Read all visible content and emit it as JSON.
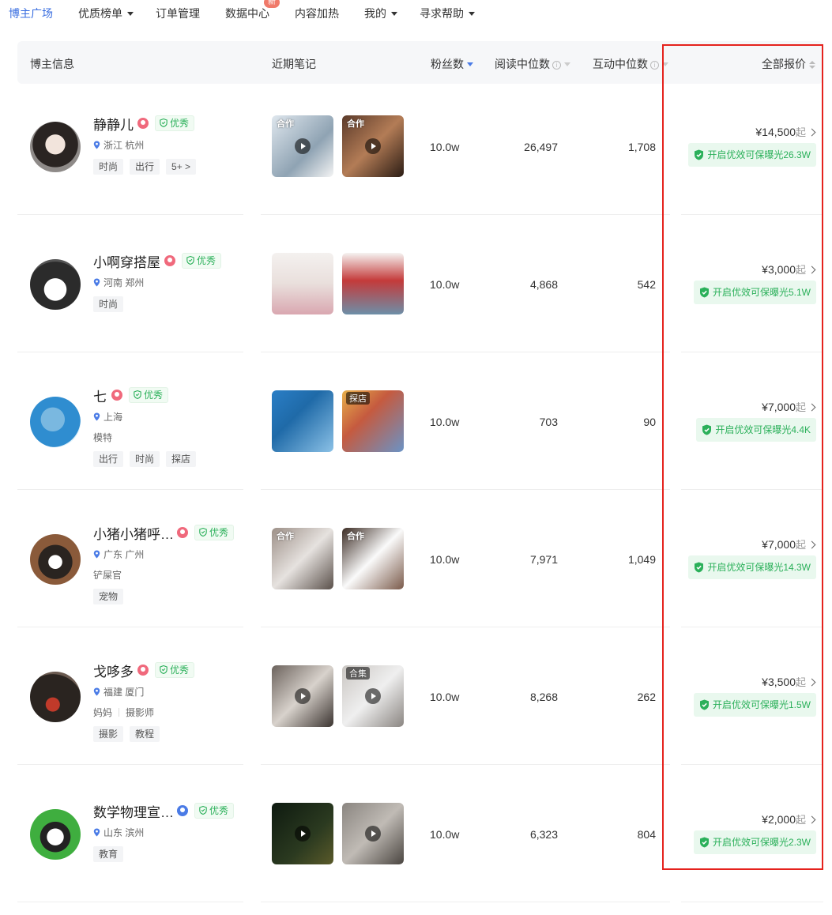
{
  "nav": {
    "items": [
      {
        "label": "博主广场",
        "active": true,
        "dropdown": false
      },
      {
        "label": "优质榜单",
        "active": false,
        "dropdown": true
      },
      {
        "label": "订单管理",
        "active": false,
        "dropdown": false
      },
      {
        "label": "数据中心",
        "active": false,
        "dropdown": false
      },
      {
        "label": "内容加热",
        "active": false,
        "dropdown": false
      },
      {
        "label": "我的",
        "active": false,
        "dropdown": true
      },
      {
        "label": "寻求帮助",
        "active": false,
        "dropdown": true
      }
    ],
    "new_badge": "新"
  },
  "table": {
    "headers": {
      "blogger_info": "博主信息",
      "recent_notes": "近期笔记",
      "fans": "粉丝数",
      "read_median": "阅读中位数",
      "interact_median": "互动中位数",
      "all_price": "全部报价"
    },
    "rows": [
      {
        "name": "静静儿",
        "gender": "female",
        "badge": "优秀",
        "location": "浙江 杭州",
        "roles": [],
        "tags": [
          "时尚",
          "出行",
          "5+ >"
        ],
        "notes": [
          {
            "label": "合作",
            "boxed": false,
            "video": true
          },
          {
            "label": "合作",
            "boxed": false,
            "video": true
          }
        ],
        "fans": "10.0w",
        "read_median": "26,497",
        "interact_median": "1,708",
        "price": "¥14,500",
        "price_suffix": "起",
        "guarantee": "开启优效可保曝光26.3W"
      },
      {
        "name": "小啊穿搭屋",
        "gender": "female",
        "badge": "优秀",
        "location": "河南 郑州",
        "roles": [],
        "tags": [
          "时尚"
        ],
        "notes": [
          {
            "label": "",
            "boxed": false,
            "video": false
          },
          {
            "label": "",
            "boxed": false,
            "video": false
          }
        ],
        "fans": "10.0w",
        "read_median": "4,868",
        "interact_median": "542",
        "price": "¥3,000",
        "price_suffix": "起",
        "guarantee": "开启优效可保曝光5.1W"
      },
      {
        "name": "七",
        "gender": "female",
        "badge": "优秀",
        "location": "上海",
        "roles": [
          "模特"
        ],
        "tags": [
          "出行",
          "时尚",
          "探店"
        ],
        "notes": [
          {
            "label": "",
            "boxed": false,
            "video": false
          },
          {
            "label": "探店",
            "boxed": true,
            "video": false
          }
        ],
        "fans": "10.0w",
        "read_median": "703",
        "interact_median": "90",
        "price": "¥7,000",
        "price_suffix": "起",
        "guarantee": "开启优效可保曝光4.4K"
      },
      {
        "name": "小猪小猪呼…",
        "gender": "female",
        "badge": "优秀",
        "location": "广东 广州",
        "roles": [
          "铲屎官"
        ],
        "tags": [
          "宠物"
        ],
        "notes": [
          {
            "label": "合作",
            "boxed": false,
            "video": false
          },
          {
            "label": "合作",
            "boxed": false,
            "video": false
          }
        ],
        "fans": "10.0w",
        "read_median": "7,971",
        "interact_median": "1,049",
        "price": "¥7,000",
        "price_suffix": "起",
        "guarantee": "开启优效可保曝光14.3W"
      },
      {
        "name": "戈哆多",
        "gender": "female",
        "badge": "优秀",
        "location": "福建 厦门",
        "roles": [
          "妈妈",
          "摄影师"
        ],
        "tags": [
          "摄影",
          "教程"
        ],
        "notes": [
          {
            "label": "",
            "boxed": false,
            "video": true
          },
          {
            "label": "合集",
            "boxed": true,
            "video": true
          }
        ],
        "fans": "10.0w",
        "read_median": "8,268",
        "interact_median": "262",
        "price": "¥3,500",
        "price_suffix": "起",
        "guarantee": "开启优效可保曝光1.5W"
      },
      {
        "name": "数学物理宣…",
        "gender": "male",
        "badge": "优秀",
        "location": "山东 滨州",
        "roles": [],
        "tags": [
          "教育"
        ],
        "notes": [
          {
            "label": "",
            "boxed": false,
            "video": true
          },
          {
            "label": "",
            "boxed": false,
            "video": true
          }
        ],
        "fans": "10.0w",
        "read_median": "6,323",
        "interact_median": "804",
        "price": "¥2,000",
        "price_suffix": "起",
        "guarantee": "开启优效可保曝光2.3W"
      }
    ]
  },
  "colors": {
    "accent": "#3b6fe0",
    "success": "#2bb05a",
    "highlight_frame": "#e5221d",
    "female": "#f0697c",
    "male": "#4a7be6"
  },
  "icons": {
    "location": "pin-icon",
    "badge": "shield-icon",
    "play": "play-icon",
    "info": "info-icon",
    "chevron": "chevron-right-icon"
  }
}
